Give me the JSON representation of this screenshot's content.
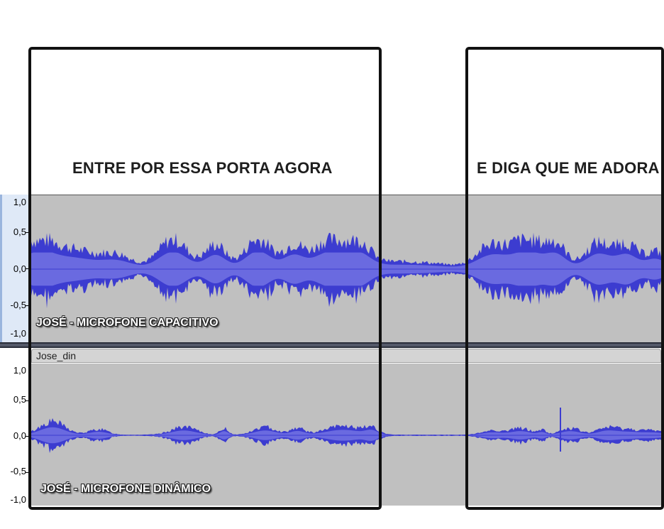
{
  "captions": {
    "left": "ENTRE POR ESSA PORTA AGORA",
    "right": "E DIGA QUE ME ADORA"
  },
  "tracks": [
    {
      "name": "",
      "label": "JOSÉ - MICROFONE CAPACITIVO",
      "wave_color": "#3c3cd0",
      "ruler_ticks": [
        "1,0",
        "0,5",
        "0,0",
        "-0,5",
        "-1,0"
      ]
    },
    {
      "name": "Jose_din",
      "label": "JOSÉ - MICROFONE DINÂMICO",
      "wave_color": "#3c3cd0",
      "ruler_ticks": [
        "1,0",
        "0,5",
        "0,0",
        "-0,5",
        "-1,0"
      ]
    }
  ],
  "colors": {
    "track_bg": "#c0c0c0",
    "waveform": "#3c3cd0",
    "waveform_rms": "#6a6ae0",
    "frame": "#111111"
  }
}
